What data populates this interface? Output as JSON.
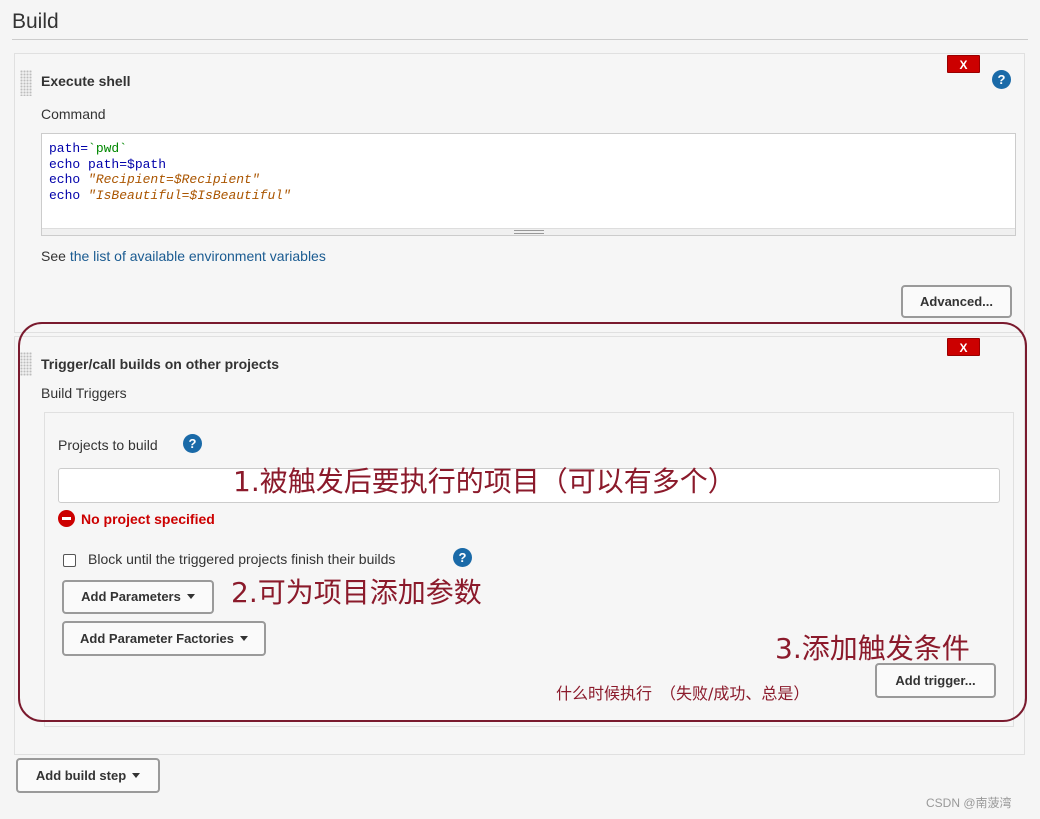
{
  "section": {
    "title": "Build"
  },
  "execute_shell": {
    "title": "Execute shell",
    "delete_label": "X",
    "help_label": "?",
    "command_label": "Command",
    "code_lines": [
      {
        "kw": "path=",
        "rest": "`pwd`"
      },
      {
        "kw": "echo ",
        "rest": "path=$path"
      },
      {
        "kw": "echo ",
        "rest": "\"Recipient=$Recipient\""
      },
      {
        "kw": "echo ",
        "rest": "\"IsBeautiful=$IsBeautiful\""
      }
    ],
    "see_prefix": "See",
    "env_link": "the list of available environment variables",
    "advanced_label": "Advanced..."
  },
  "trigger": {
    "title": "Trigger/call builds on other projects",
    "delete_label": "X",
    "build_triggers_label": "Build Triggers",
    "projects_label": "Projects to build",
    "help_label": "?",
    "projects_value": "",
    "error_text": "No project specified",
    "block_label": "Block until the triggered projects finish their builds",
    "block_checked": false,
    "add_parameters_label": "Add Parameters",
    "add_param_factories_label": "Add Parameter Factories",
    "add_trigger_label": "Add trigger..."
  },
  "add_build_step_label": "Add build step",
  "annotations": {
    "note1": "1.被触发后要执行的项目（可以有多个）",
    "note2": "2.可为项目添加参数",
    "note3": "3.添加触发条件",
    "note4": "什么时候执行　（失败/成功、总是）"
  },
  "watermark": "CSDN @南菠湾",
  "colors": {
    "annotation": "#8b1a2b",
    "delete_button": "#cc0000",
    "help_icon": "#1a6aa8",
    "link": "#1a5b91",
    "error": "#cc0000"
  }
}
